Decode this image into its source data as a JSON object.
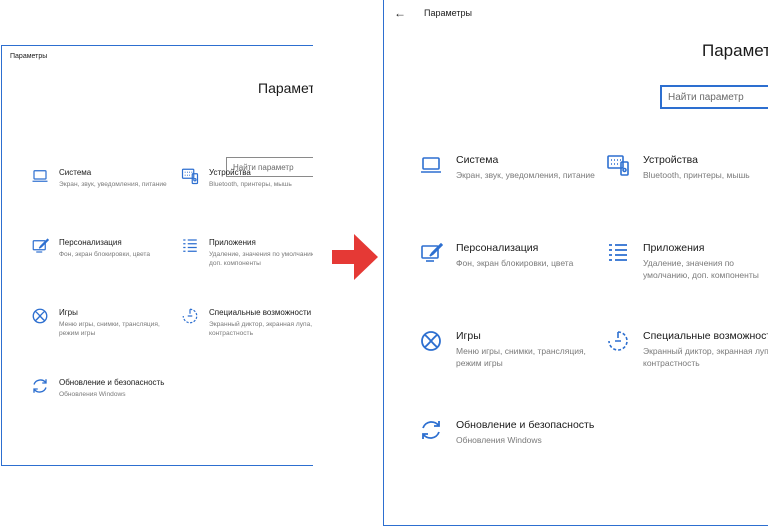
{
  "window_title": "Параметры",
  "header": "Параметры",
  "search_placeholder": "Найти параметр",
  "accent_color": "#2d6fd0",
  "arrow_color": "#e53935",
  "tiles": [
    {
      "title": "Система",
      "desc": "Экран, звук, уведомления, питание",
      "icon": "laptop-icon"
    },
    {
      "title": "Устройства",
      "desc": "Bluetooth, принтеры, мышь",
      "icon": "keyboard-icon"
    },
    {
      "title": "Персонализация",
      "desc": "Фон, экран блокировки, цвета",
      "icon": "paint-icon"
    },
    {
      "title": "Приложения",
      "desc": "Удаление, значения по умолчанию, доп. компоненты",
      "icon": "apps-list-icon"
    },
    {
      "title": "Игры",
      "desc": "Меню игры, снимки, трансляция, режим игры",
      "icon": "xbox-icon"
    },
    {
      "title": "Специальные возможности",
      "desc": "Экранный диктор, экранная лупа, контрастность",
      "icon": "ease-of-access-icon"
    },
    {
      "title": "Обновление и безопасность",
      "desc": "Обновления Windows",
      "icon": "update-icon"
    }
  ]
}
